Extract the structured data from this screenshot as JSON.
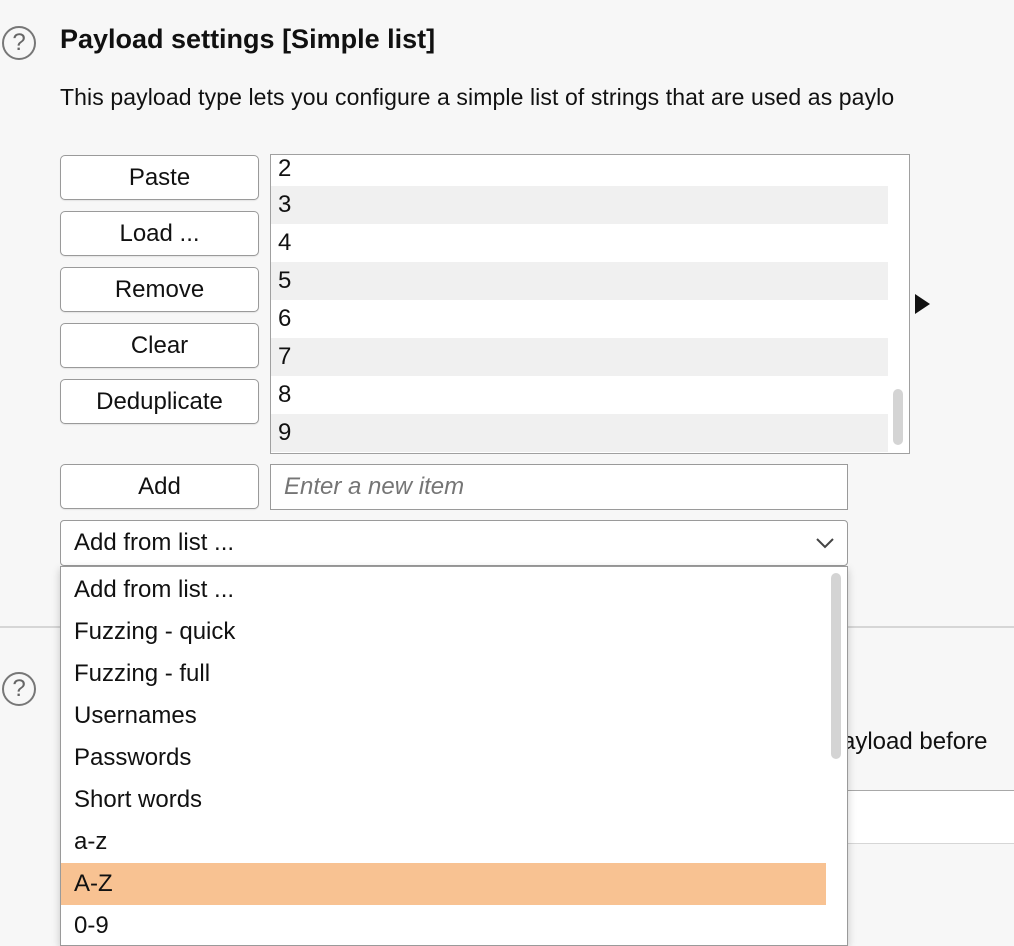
{
  "section": {
    "title": "Payload settings [Simple list]",
    "description": "This payload type lets you configure a simple list of strings that are used as paylo"
  },
  "buttons": {
    "paste": "Paste",
    "load": "Load ...",
    "remove": "Remove",
    "clear": "Clear",
    "deduplicate": "Deduplicate",
    "add": "Add"
  },
  "payload_list": {
    "items": [
      "2",
      "3",
      "4",
      "5",
      "6",
      "7",
      "8",
      "9"
    ]
  },
  "new_item": {
    "placeholder": "Enter a new item",
    "value": ""
  },
  "add_from_list": {
    "selected": "Add from list ...",
    "options": [
      "Add from list ...",
      "Fuzzing - quick",
      "Fuzzing - full",
      "Usernames",
      "Passwords",
      "Short words",
      "a-z",
      "A-Z",
      "0-9"
    ],
    "highlighted": "A-Z",
    "highlight_color": "#f8c292"
  },
  "next_section": {
    "partial_text": "ayload before"
  }
}
